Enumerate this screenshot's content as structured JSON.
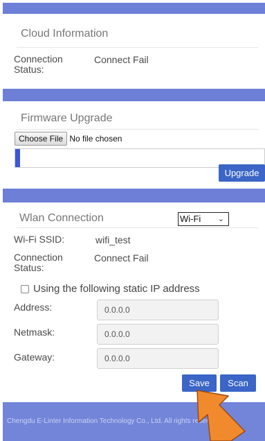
{
  "cloud": {
    "title": "Cloud Information",
    "status_label": "Connection Status:",
    "status_value": "Connect Fail"
  },
  "firmware": {
    "title": "Firmware Upgrade",
    "choose_file_label": "Choose File",
    "file_status": "No file chosen",
    "progress": 0.02,
    "upgrade_label": "Upgrade"
  },
  "wlan": {
    "title": "Wlan Connection",
    "mode_selected": "Wi-Fi",
    "ssid_label": "Wi-Fi SSID:",
    "ssid_value": "wifi_test",
    "status_label": "Connection Status:",
    "status_value": "Connect Fail",
    "static_ip_label": "Using the following static IP address",
    "static_ip_checked": false,
    "address_label": "Address:",
    "address_value": "0.0.0.0",
    "netmask_label": "Netmask:",
    "netmask_value": "0.0.0.0",
    "gateway_label": "Gateway:",
    "gateway_value": "0.0.0.0",
    "save_label": "Save",
    "scan_label": "Scan"
  },
  "footer": {
    "text": "Chengdu E-Linter Information Technology Co., Ltd. All rights reserved"
  },
  "icons": {
    "dropdown": "chevron-down-icon",
    "pointer": "pointer-arrow-icon"
  },
  "colors": {
    "band": "#6d7fd6",
    "button": "#3b65c6",
    "footer": "#7385d9",
    "progress": "#3b57d9",
    "arrow": "#f08a2c"
  }
}
